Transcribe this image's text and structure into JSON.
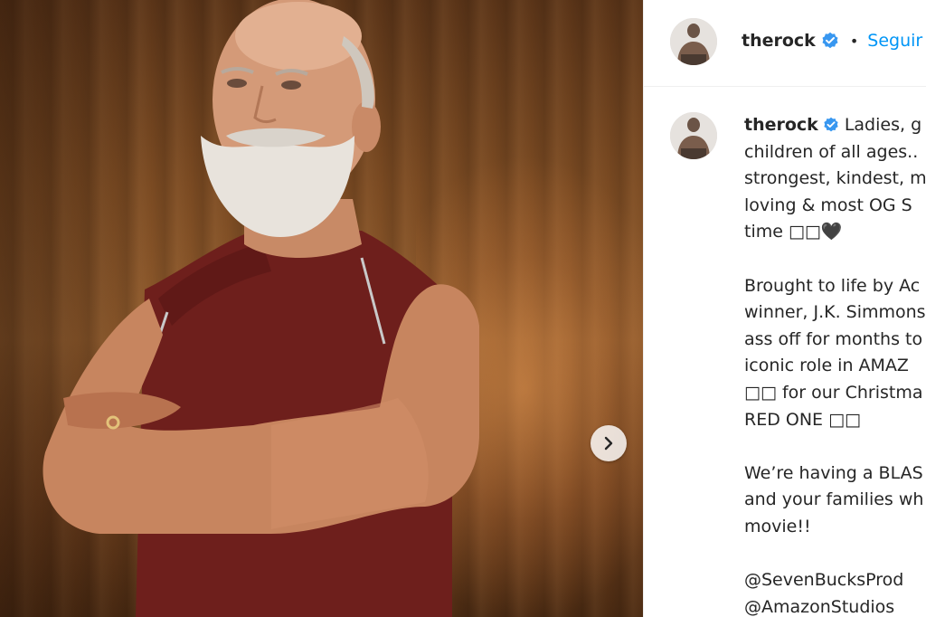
{
  "post": {
    "username": "therock",
    "verified": true,
    "follow_label": "Seguir",
    "separator": "•"
  },
  "caption": {
    "username": "therock",
    "lines": [
      "Ladies, g",
      "children of all ages..",
      "strongest, kindest, m",
      "loving & most OG S",
      "time □□🖤",
      "",
      "Brought to life by Ac",
      "winner, J.K. Simmons",
      "ass off for months to",
      "iconic role in AMAZ",
      "□□ for our Christma",
      "RED ONE □□",
      "",
      "We’re having a BLAS",
      "and your families wh",
      "movie!!",
      "",
      "@SevenBucksProd",
      "@AmazonStudios"
    ]
  },
  "icons": {
    "verified": "verified-badge-icon",
    "next": "chevron-right-icon"
  },
  "colors": {
    "accent": "#0095f6",
    "text": "#262626",
    "verified": "#3897f0",
    "divider": "#efefef"
  }
}
